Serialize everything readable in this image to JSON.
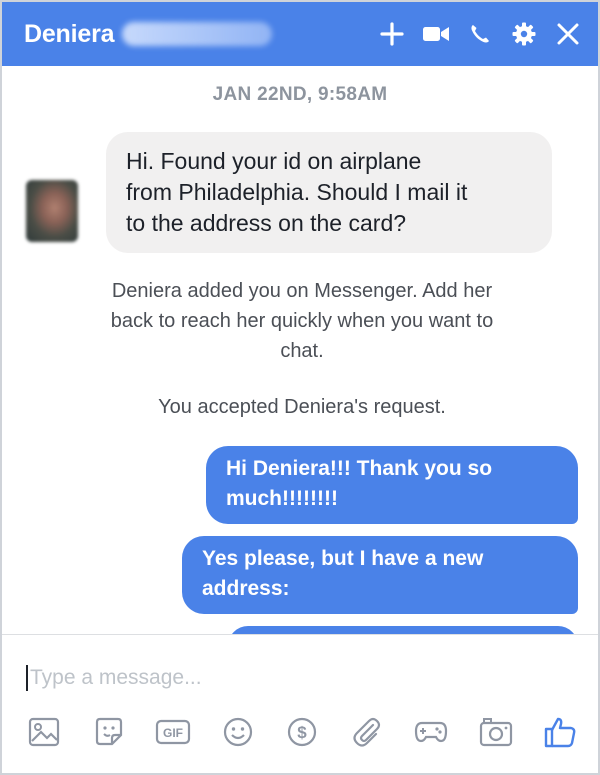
{
  "header": {
    "contact_name": "Deniera",
    "actions": [
      "plus-icon",
      "video-icon",
      "phone-icon",
      "gear-icon",
      "close-icon"
    ]
  },
  "conversation": {
    "timestamp": "JAN 22ND, 9:58AM",
    "incoming": {
      "lines": [
        "Hi. Found your id on airplane",
        "from Philadelphia. Should I mail it",
        "to the address on the card?"
      ]
    },
    "notices": [
      {
        "lines": [
          "Deniera added you on Messenger. Add her",
          "back to reach her quickly when you want to",
          "chat."
        ]
      },
      {
        "lines": [
          "You accepted Deniera's request."
        ]
      }
    ],
    "outgoing": [
      {
        "lines": [
          "Hi Deniera!!! Thank you so",
          "much!!!!!!!!"
        ]
      },
      {
        "lines": [
          "Yes please, but I have a new",
          "address:"
        ]
      }
    ]
  },
  "composer": {
    "placeholder": "Type a message...",
    "tools": [
      "image-icon",
      "sticker-icon",
      "gif-icon",
      "emoji-icon",
      "payment-icon",
      "attachment-icon",
      "game-icon",
      "camera-icon",
      "like-icon"
    ]
  },
  "colors": {
    "brand_blue": "#4a82e8",
    "incoming_bubble": "#f1f0f0",
    "muted_text": "#8d949e"
  }
}
